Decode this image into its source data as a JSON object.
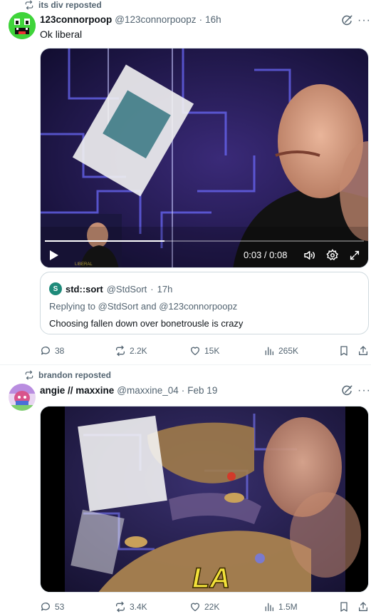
{
  "post1": {
    "repost_text": "its div reposted",
    "author_name": "123connorpoop",
    "author_handle": "@123connorpoopz",
    "separator": "·",
    "time": "16h",
    "text": "Ok liberal",
    "video": {
      "time_display": "0:03 / 0:08",
      "progress": 0.375,
      "thumbnail_caption": "LIBERAL"
    },
    "quote": {
      "avatar_letter": "S",
      "name": "std::sort",
      "handle": "@StdSort",
      "separator": "·",
      "time": "17h",
      "reply_prefix": "Replying to",
      "reply_user1": "@StdSort",
      "reply_and": "and",
      "reply_user2": "@123connorpoopz",
      "text": "Choosing fallen down over bonetrousle is crazy"
    },
    "actions": {
      "replies": "38",
      "reposts": "2.2K",
      "likes": "15K",
      "views": "265K"
    }
  },
  "post2": {
    "repost_text": "brandon reposted",
    "author_name": "angie // maxxine",
    "author_handle": "@maxxine_04",
    "separator": "·",
    "time": "Feb 19",
    "video": {
      "overlay_text": "LA"
    },
    "actions": {
      "replies": "53",
      "reposts": "3.4K",
      "likes": "22K",
      "views": "1.5M"
    }
  },
  "colors": {
    "text_primary": "#0f1419",
    "text_secondary": "#536471",
    "border": "#cfd9de",
    "avatar_green": "#3fd43a",
    "quote_avatar": "#1e8a7a"
  },
  "icons": [
    "repost-icon",
    "grok-icon",
    "more-icon",
    "play-icon",
    "volume-icon",
    "settings-icon",
    "fullscreen-icon",
    "reply-icon",
    "heart-icon",
    "views-icon",
    "bookmark-icon",
    "share-icon"
  ]
}
